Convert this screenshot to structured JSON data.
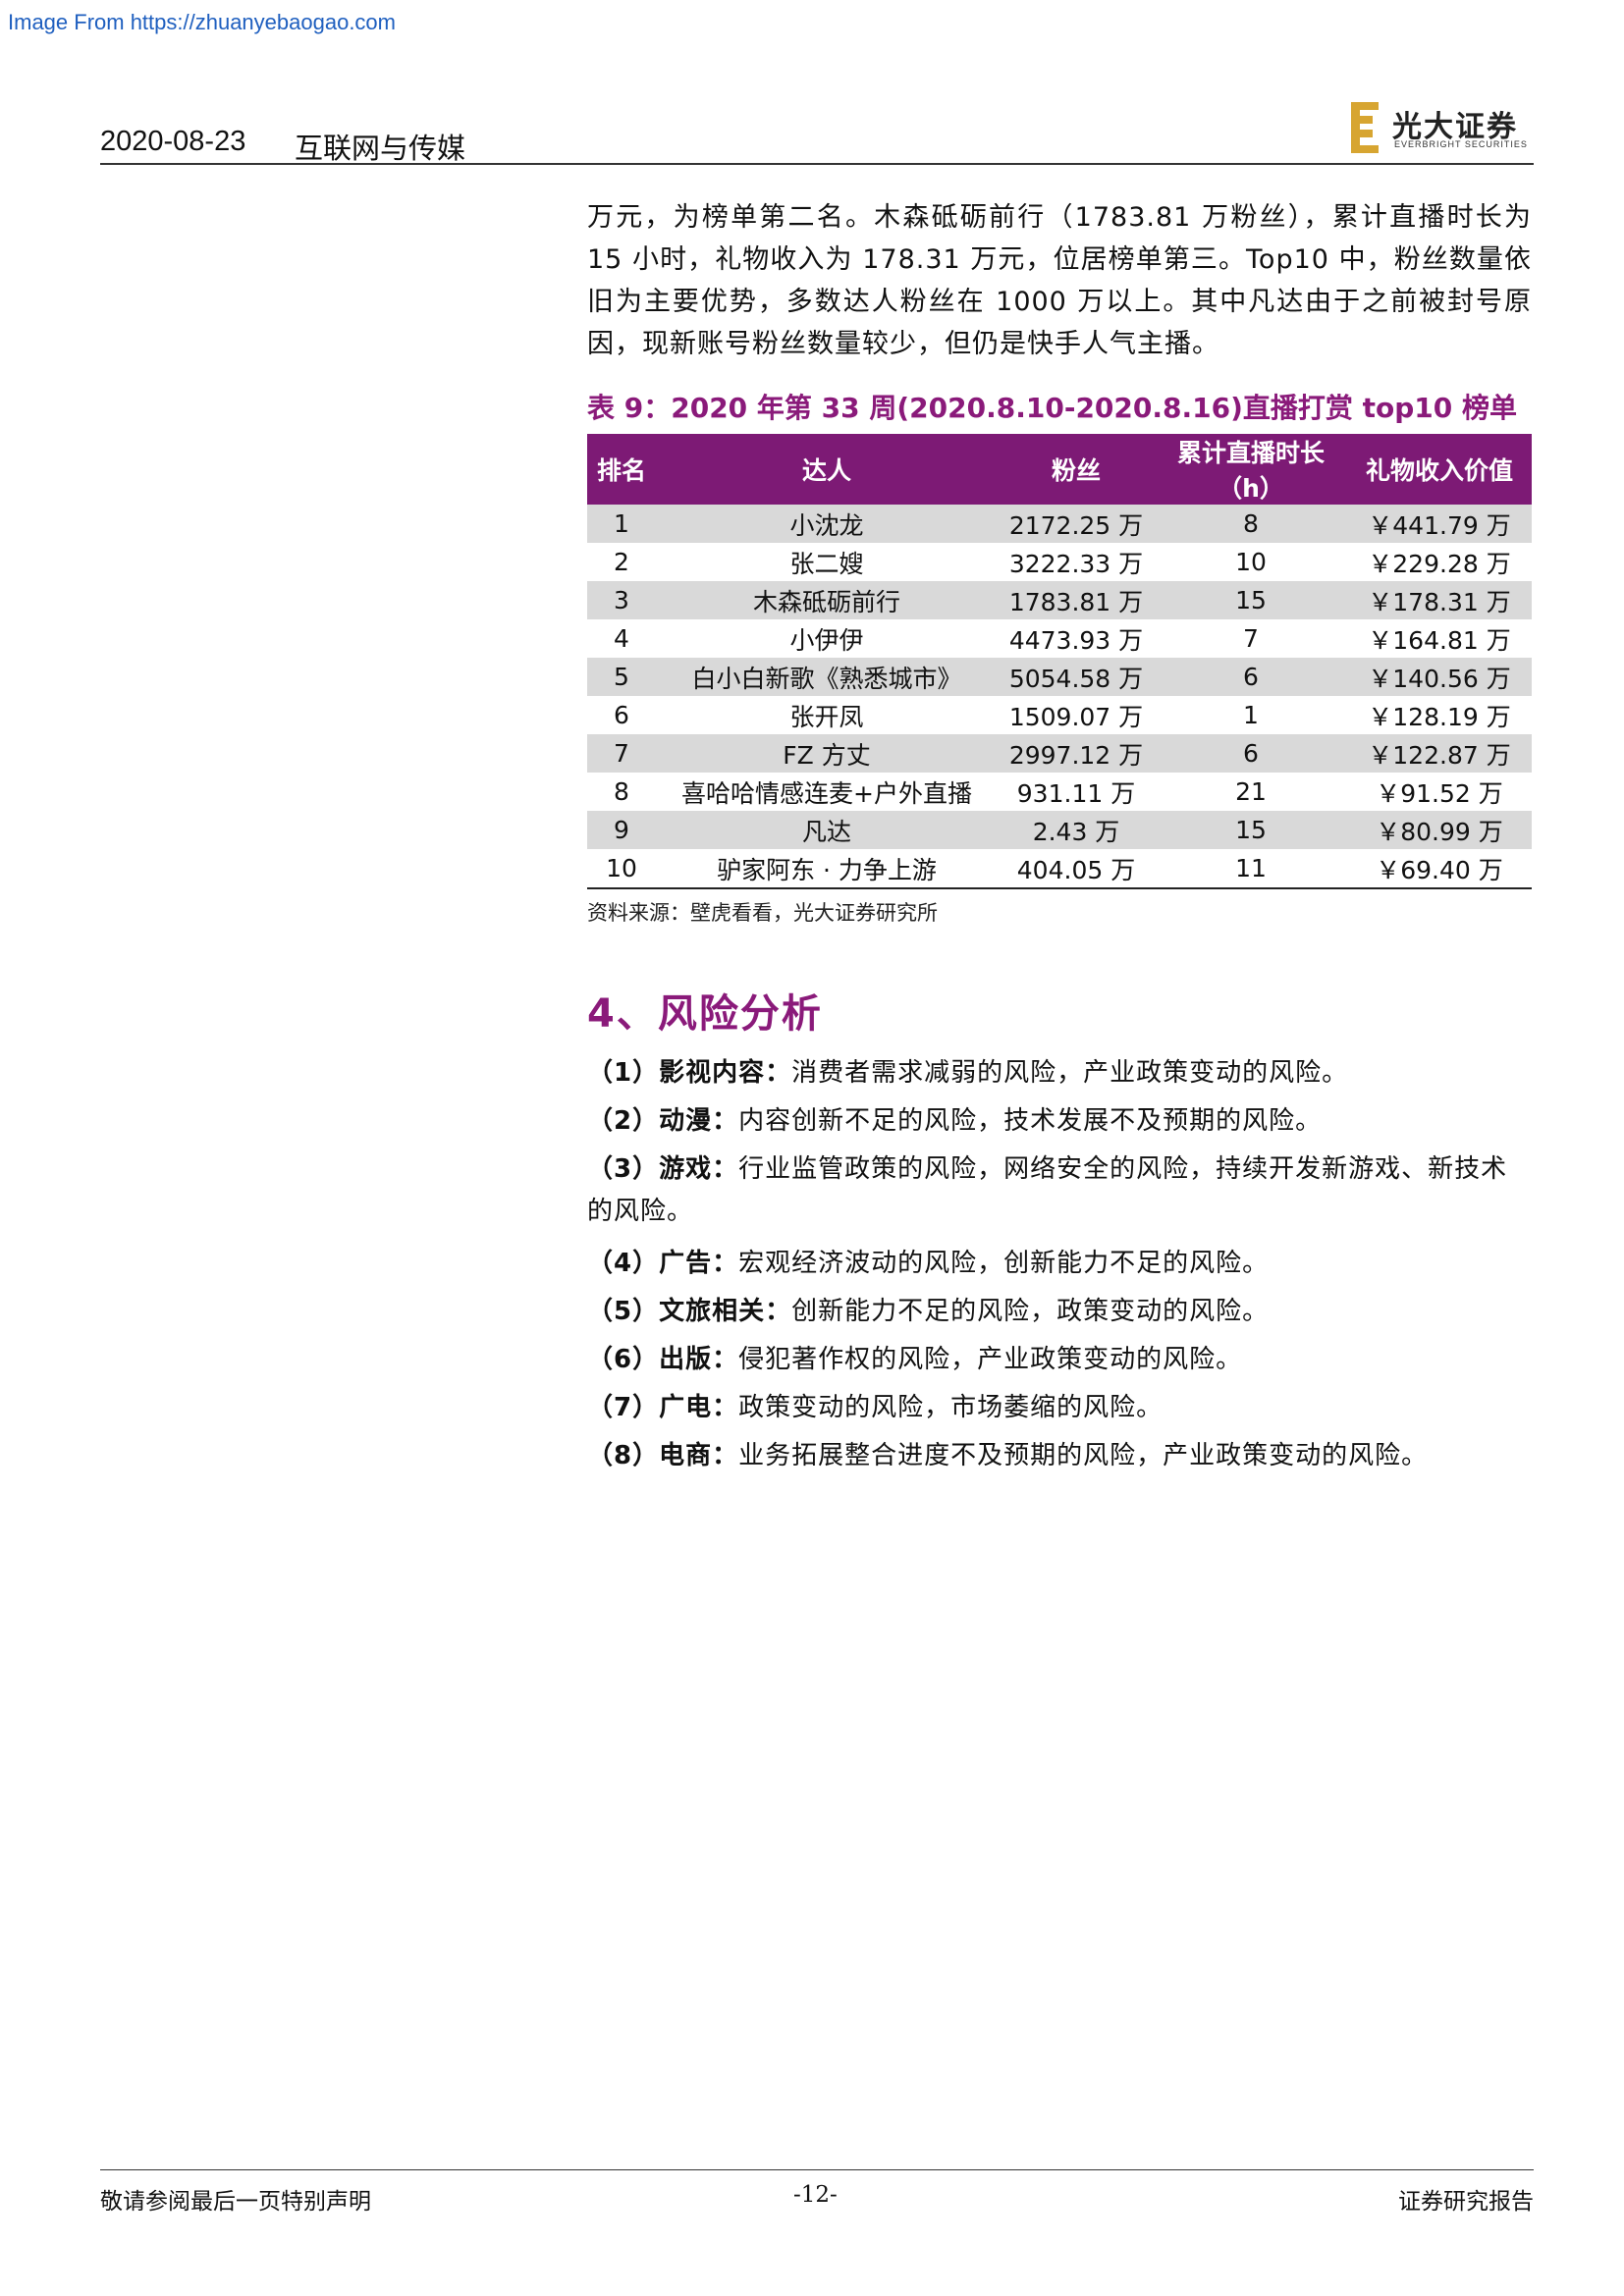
{
  "watermark": "Image From https://zhuanyebaogao.com",
  "header": {
    "date": "2020-08-23",
    "sector": "互联网与传媒",
    "logo_cn": "光大证券",
    "logo_en": "EVERBRIGHT SECURITIES"
  },
  "intro_lines": [
    "万元，为榜单第二名。木森砥砺前行（1783.81 万粉丝），累计直播时长为",
    "15 小时，礼物收入为 178.31 万元，位居榜单第三。Top10 中，粉丝数量依",
    "旧为主要优势，多数达人粉丝在 1000 万以上。其中凡达由于之前被封号原",
    "因，现新账号粉丝数量较少，但仍是快手人气主播。"
  ],
  "table": {
    "title": "表 9：2020 年第 33 周(2020.8.10-2020.8.16)直播打赏 top10 榜单",
    "headers": [
      "排名",
      "达人",
      "粉丝",
      "累计直播时长（h）",
      "礼物收入价值"
    ],
    "rows": [
      [
        "1",
        "小沈龙",
        "2172.25 万",
        "8",
        "￥441.79 万"
      ],
      [
        "2",
        "张二嫂",
        "3222.33 万",
        "10",
        "￥229.28 万"
      ],
      [
        "3",
        "木森砥砺前行",
        "1783.81 万",
        "15",
        "￥178.31 万"
      ],
      [
        "4",
        "小伊伊",
        "4473.93 万",
        "7",
        "￥164.81 万"
      ],
      [
        "5",
        "白小白新歌《熟悉城市》",
        "5054.58 万",
        "6",
        "￥140.56 万"
      ],
      [
        "6",
        "张开凤",
        "1509.07 万",
        "1",
        "￥128.19 万"
      ],
      [
        "7",
        "FZ 方丈",
        "2997.12 万",
        "6",
        "￥122.87 万"
      ],
      [
        "8",
        "喜哈哈情感连麦+户外直播",
        "931.11 万",
        "21",
        "￥91.52 万"
      ],
      [
        "9",
        "凡达",
        "2.43 万",
        "15",
        "￥80.99 万"
      ],
      [
        "10",
        "驴家阿东 · 力争上游",
        "404.05 万",
        "11",
        "￥69.40 万"
      ]
    ],
    "source": "资料来源：壁虎看看，光大证券研究所"
  },
  "section_title": "4、风险分析",
  "risks": [
    {
      "num": "（1）",
      "cat": "影视内容：",
      "text": "消费者需求减弱的风险，产业政策变动的风险。"
    },
    {
      "num": "（2）",
      "cat": "动漫：",
      "text": "内容创新不足的风险，技术发展不及预期的风险。"
    },
    {
      "num": "（3）",
      "cat": "游戏：",
      "text": "行业监管政策的风险，网络安全的风险，持续开发新游戏、新技术的风险。"
    },
    {
      "num": "（4）",
      "cat": "广告：",
      "text": "宏观经济波动的风险，创新能力不足的风险。"
    },
    {
      "num": "（5）",
      "cat": "文旅相关：",
      "text": "创新能力不足的风险，政策变动的风险。"
    },
    {
      "num": "（6）",
      "cat": "出版：",
      "text": "侵犯著作权的风险，产业政策变动的风险。"
    },
    {
      "num": "（7）",
      "cat": "广电：",
      "text": "政策变动的风险，市场萎缩的风险。"
    },
    {
      "num": "（8）",
      "cat": "电商：",
      "text": "业务拓展整合进度不及预期的风险，产业政策变动的风险。"
    }
  ],
  "footer": {
    "left": "敬请参阅最后一页特别声明",
    "page": "-12-",
    "right": "证券研究报告"
  },
  "colors": {
    "accent": "#7d1a75",
    "title": "#8a1a7a",
    "logo_gold": "#d7a531",
    "row_shade": "#d9d9d9"
  }
}
